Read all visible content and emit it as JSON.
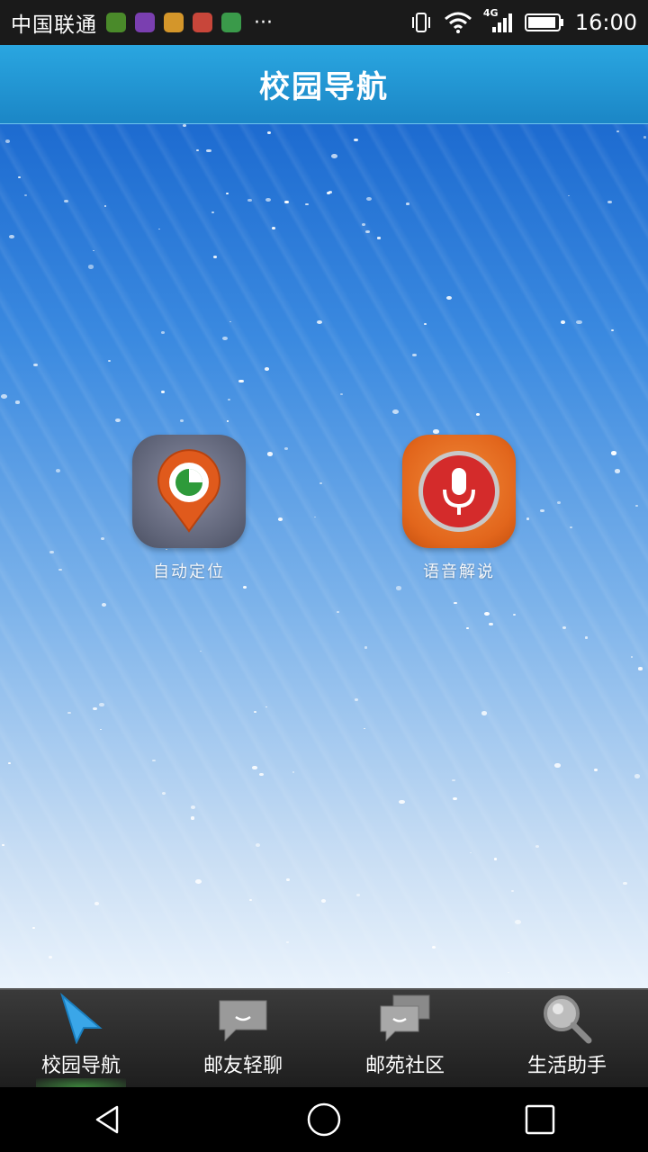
{
  "status_bar": {
    "carrier": "中国联通",
    "time": "16:00",
    "network": "4G",
    "more": "···",
    "notification_icons": [
      "app-icon-green",
      "gallery-icon",
      "hand-icon",
      "settings-icon",
      "grid-icon"
    ]
  },
  "header": {
    "title": "校园导航"
  },
  "features": [
    {
      "label": "自动定位",
      "icon": "location-pin-icon"
    },
    {
      "label": "语音解说",
      "icon": "microphone-icon"
    }
  ],
  "tabs": [
    {
      "label": "校园导航",
      "icon": "navigation-arrow-icon",
      "active": true
    },
    {
      "label": "邮友轻聊",
      "icon": "chat-bubble-icon",
      "active": false
    },
    {
      "label": "邮苑社区",
      "icon": "chat-bubbles-icon",
      "active": false
    },
    {
      "label": "生活助手",
      "icon": "search-icon",
      "active": false
    }
  ],
  "colors": {
    "title_bar": "#1b86c6",
    "tab_bar": "#2a2a2a",
    "tab_active_glow": "#50c850"
  }
}
